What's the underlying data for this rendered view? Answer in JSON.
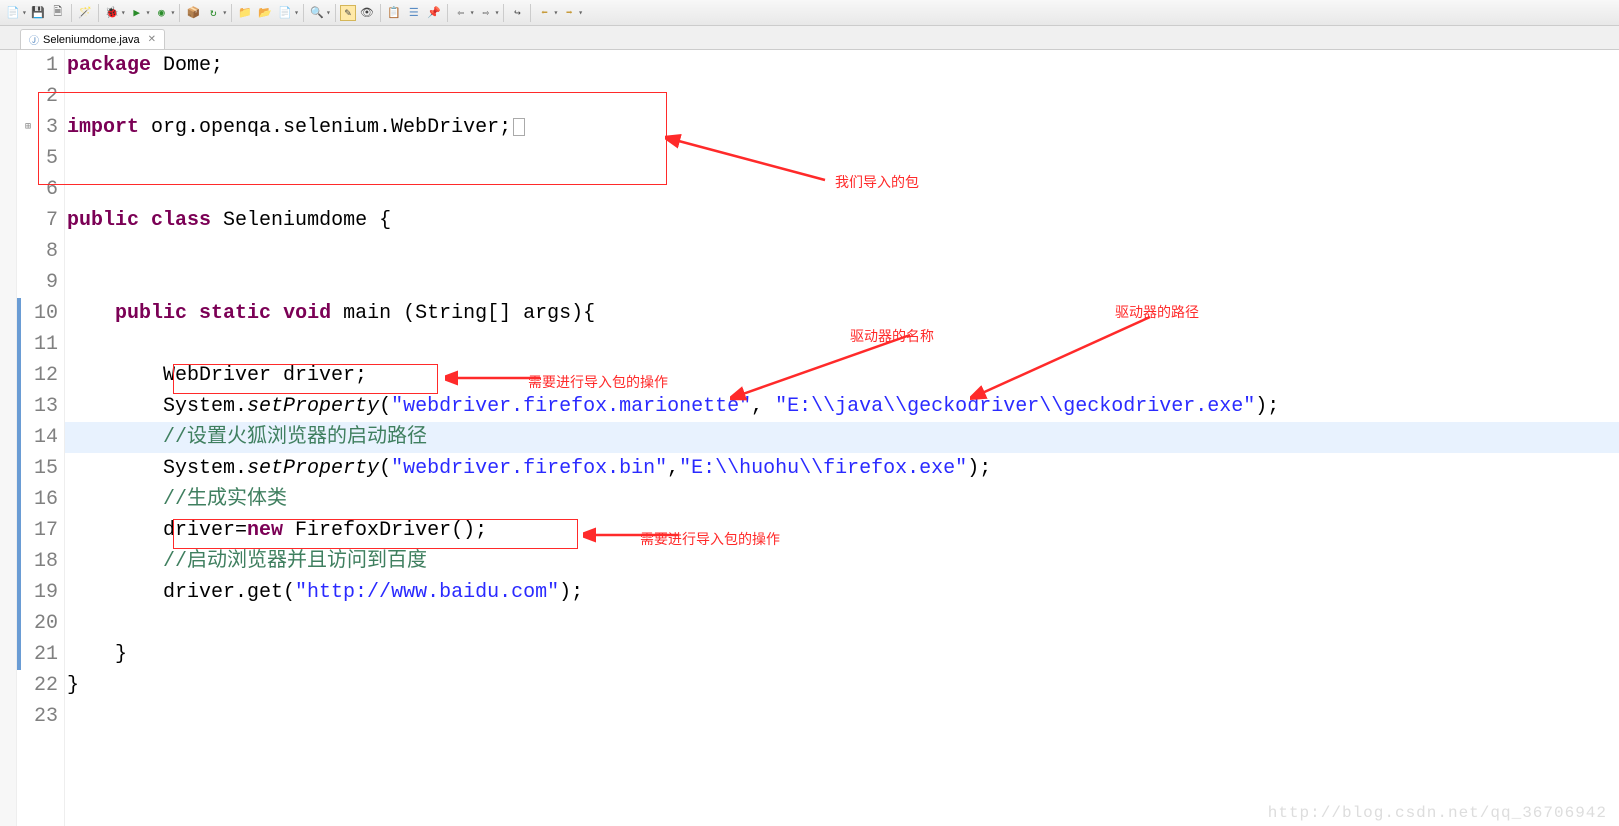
{
  "tab": {
    "filename": "Seleniumdome.java"
  },
  "lines": {
    "l1_kw": "package",
    "l1_rest": " Dome;",
    "l3_kw": "import",
    "l3_rest": " org.openqa.selenium.WebDriver;",
    "l7_kw_public": "public",
    "l7_kw_class": "class",
    "l7_name": " Seleniumdome {",
    "l10_kw_public": "public",
    "l10_kw_static": "static",
    "l10_kw_void": "void",
    "l10_rest": " main (String[] args){",
    "l12": "WebDriver driver;",
    "l13_a": "System.",
    "l13_m": "setProperty",
    "l13_b": "(",
    "l13_s1": "\"webdriver.firefox.marionette\"",
    "l13_c": ", ",
    "l13_s2": "\"E:\\\\java\\\\geckodriver\\\\geckodriver.exe\"",
    "l13_d": ");",
    "l14_com": "//设置火狐浏览器的启动路径",
    "l15_a": "System.",
    "l15_m": "setProperty",
    "l15_b": "(",
    "l15_s1": "\"webdriver.firefox.bin\"",
    "l15_c": ",",
    "l15_s2": "\"E:\\\\huohu\\\\firefox.exe\"",
    "l15_d": ");",
    "l16_com": "//生成实体类",
    "l17_a": "driver=",
    "l17_kw": "new",
    "l17_b": " FirefoxDriver();",
    "l18_com": "//启动浏览器并且访问到百度",
    "l19_a": "driver.get(",
    "l19_s": "\"http://www.baidu.com\"",
    "l19_b": ");",
    "l21": "}",
    "l22": "}"
  },
  "gutter": [
    "1",
    "2",
    "3",
    "5",
    "6",
    "7",
    "8",
    "9",
    "10",
    "11",
    "12",
    "13",
    "14",
    "15",
    "16",
    "17",
    "18",
    "19",
    "20",
    "21",
    "22",
    "23"
  ],
  "annotations": {
    "a1": "我们导入的包",
    "a2": "驱动器的名称",
    "a3": "驱动器的路径",
    "a4": "需要进行导入包的操作",
    "a5": "需要进行导入包的操作"
  },
  "watermark": "http://blog.csdn.net/qq_36706942"
}
